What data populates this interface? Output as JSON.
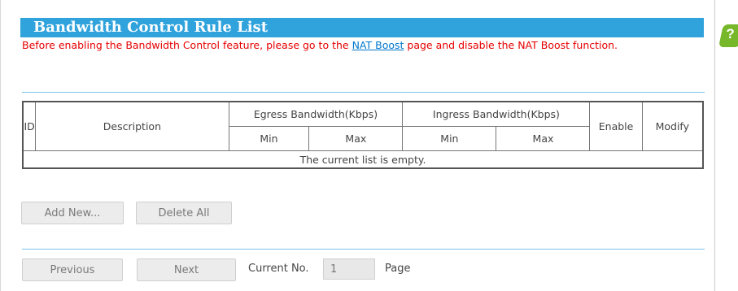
{
  "panel": {
    "title": "Bandwidth Control Rule List",
    "help_label": "?",
    "warning": {
      "before": "Before enabling the Bandwidth Control feature, please go to the ",
      "link": "NAT Boost",
      "after": " page and disable the NAT Boost function."
    }
  },
  "table": {
    "headers": {
      "id": "ID",
      "description": "Description",
      "egress": "Egress Bandwidth(Kbps)",
      "ingress": "Ingress Bandwidth(Kbps)",
      "enable": "Enable",
      "modify": "Modify",
      "min": "Min",
      "max": "Max"
    },
    "empty_message": "The current list is empty."
  },
  "actions": {
    "add_new": "Add New...",
    "delete_all": "Delete All"
  },
  "pager": {
    "previous": "Previous",
    "next": "Next",
    "current_label": "Current No.",
    "current_value": "1",
    "page_label": "Page"
  },
  "colors": {
    "title_bar": "#31a3dc",
    "warning_text": "#e60000",
    "link": "#0077cc",
    "help_badge": "#76b82a",
    "divider": "#7ec3ea"
  }
}
